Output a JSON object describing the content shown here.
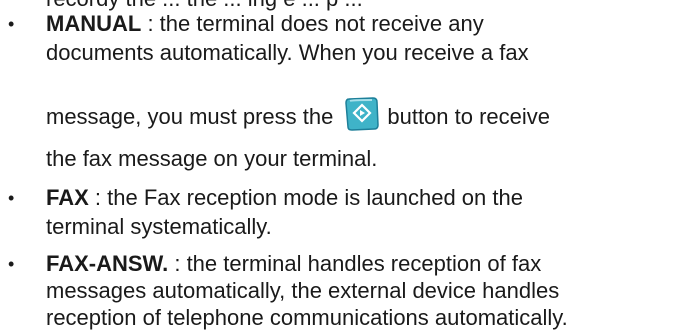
{
  "document": {
    "top_fragment": "recordy   ...   e ...   ...   e ...   ...   g ...   ...   p ...",
    "items": [
      {
        "bullet": "•",
        "term": "MANUAL",
        "line1_rest": " : the terminal does not receive any",
        "line2": "documents automatically. When you receive a fax",
        "line3_before": "message, you must press the",
        "line3_after": "button to receive",
        "line4": "the fax message on your terminal.",
        "button_icon": "start-diamond-icon"
      },
      {
        "bullet": "•",
        "term": "FAX",
        "line1_rest": " : the Fax reception mode is launched on the",
        "line2": "terminal systematically."
      },
      {
        "bullet": "•",
        "term": "FAX-ANSW.",
        "line1_rest": " : the terminal handles reception of fax",
        "line2": "messages automatically, the external device handles",
        "line3": "reception of telephone communications automatically."
      }
    ]
  },
  "colors": {
    "button_fill": "#3fb3c8",
    "button_edge": "#1d7f99",
    "text": "#1a1a1a"
  }
}
